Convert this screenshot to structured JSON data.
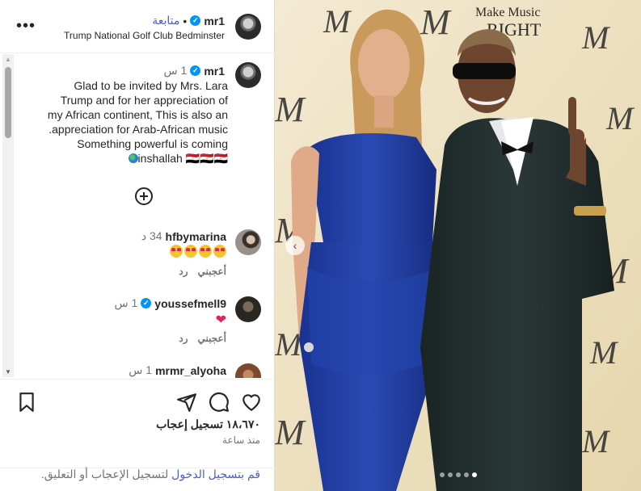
{
  "header": {
    "username": "mr1",
    "verified_icon": "verified-badge-icon",
    "separator": "•",
    "follow_label": "متابعة",
    "location": "Trump National Golf Club Bedminster",
    "menu_icon": "more-options-icon"
  },
  "caption": {
    "username": "mr1",
    "time": "1 س",
    "lines": [
      "Glad to be invited by Mrs. Lara",
      "Trump and for her appreciation of",
      "my African continent, This is also an",
      ".appreciation for Arab-African music",
      "Something powerful is coming",
      "inshallah 🇪🇬🇪🇬🇪🇬"
    ],
    "load_more_icon": "plus-circle-icon"
  },
  "comments": [
    {
      "username": "hfbymarina",
      "time": "34 د",
      "verified": false,
      "body_emojis": 4,
      "like_label": "أعجبني",
      "reply_label": "رد"
    },
    {
      "username": "youssefmell9",
      "time": "1 س",
      "verified": true,
      "body_text": "❤",
      "like_label": "أعجبني",
      "reply_label": "رد"
    },
    {
      "username": "mrmr_alyoha",
      "time": "1 س",
      "verified": false
    }
  ],
  "actions": {
    "icons": [
      "heart-icon",
      "comment-icon",
      "share-icon",
      "bookmark-icon"
    ],
    "likes_text": "١٨،٦٧٠ تسجيل إعجاب",
    "post_time": "منذ ساعة",
    "login_link": "قم بتسجيل الدخول",
    "login_rest": " لتسجيل الإعجاب أو التعليق."
  },
  "photo": {
    "backdrop_text": [
      "Make Music",
      "RIGHT"
    ],
    "carousel_count": 5,
    "carousel_active": 5,
    "prev_icon": "chevron-left-icon",
    "tag_icon": "user-tag-icon"
  },
  "colors": {
    "link": "#4a5dd6",
    "verified": "#0095f6",
    "dress": "#1e3a9a",
    "suit": "#1f2a2a",
    "backdrop": "#efe4c6"
  }
}
